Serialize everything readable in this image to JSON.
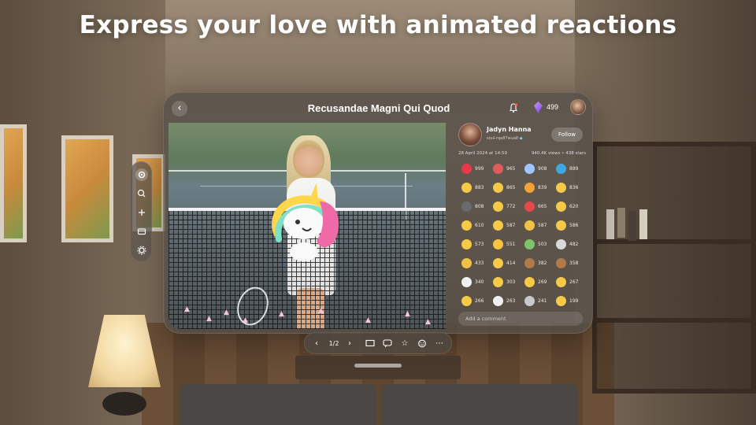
{
  "headline": "Express your love with animated reactions",
  "window": {
    "title": "Recusandae Magni Qui Quod",
    "gems": "499"
  },
  "channel": {
    "name": "Jadyn Hanna",
    "handle": "soul-rqa87wua8",
    "follow_label": "Follow",
    "date": "28 April 2024 at 14:59",
    "stats": "940.4K views • 438 stars",
    "comment_placeholder": "Add a comment"
  },
  "reactions": [
    {
      "icon": "heart-icon",
      "color": "#e8394a",
      "count": "999"
    },
    {
      "icon": "hundred-icon",
      "color": "#e05c5c",
      "count": "965"
    },
    {
      "icon": "comet-icon",
      "color": "#9fc7ff",
      "count": "908"
    },
    {
      "icon": "globe-icon",
      "color": "#3fa8e0",
      "count": "889"
    },
    {
      "icon": "hugging-face-icon",
      "color": "#f7c948",
      "count": "883"
    },
    {
      "icon": "astonished-face-icon",
      "color": "#f7c948",
      "count": "865"
    },
    {
      "icon": "party-popper-icon",
      "color": "#f0a33a",
      "count": "839"
    },
    {
      "icon": "worried-face-icon",
      "color": "#f7c948",
      "count": "836"
    },
    {
      "icon": "camera-icon",
      "color": "#6b6b6b",
      "count": "808"
    },
    {
      "icon": "heart-eyes-icon",
      "color": "#f7c948",
      "count": "772"
    },
    {
      "icon": "santa-icon",
      "color": "#e34b4b",
      "count": "665"
    },
    {
      "icon": "pleading-face-icon",
      "color": "#f7c948",
      "count": "620"
    },
    {
      "icon": "grinning-face-icon",
      "color": "#f7c948",
      "count": "610"
    },
    {
      "icon": "smiling-hearts-icon",
      "color": "#f7c948",
      "count": "587"
    },
    {
      "icon": "thumbs-up-icon",
      "color": "#f2c14a",
      "count": "587"
    },
    {
      "icon": "sunglasses-face-icon",
      "color": "#f7c948",
      "count": "586"
    },
    {
      "icon": "kissing-face-icon",
      "color": "#f7c948",
      "count": "573"
    },
    {
      "icon": "star-icon",
      "color": "#f6c342",
      "count": "551"
    },
    {
      "icon": "money-with-wings-icon",
      "color": "#7fc46b",
      "count": "503"
    },
    {
      "icon": "rocket-icon",
      "color": "#d9d9d9",
      "count": "482"
    },
    {
      "icon": "clapping-hands-icon",
      "color": "#f2c14a",
      "count": "433"
    },
    {
      "icon": "thinking-face-icon",
      "color": "#f7c948",
      "count": "414"
    },
    {
      "icon": "monkey-icon",
      "color": "#b07a4a",
      "count": "382"
    },
    {
      "icon": "see-no-evil-monkey-icon",
      "color": "#b07a4a",
      "count": "358"
    },
    {
      "icon": "ghost-icon",
      "color": "#f0f0f0",
      "count": "340"
    },
    {
      "icon": "smirking-face-icon",
      "color": "#f7c948",
      "count": "303"
    },
    {
      "icon": "tongue-face-icon",
      "color": "#f7c948",
      "count": "269"
    },
    {
      "icon": "heart-eyes-face-icon",
      "color": "#f7c948",
      "count": "267"
    },
    {
      "icon": "laughing-face-icon",
      "color": "#f7c948",
      "count": "266"
    },
    {
      "icon": "clown-face-icon",
      "color": "#f0f0f0",
      "count": "263"
    },
    {
      "icon": "alien-icon",
      "color": "#c9c9c9",
      "count": "241"
    },
    {
      "icon": "cat-face-icon",
      "color": "#f7c948",
      "count": "199"
    }
  ],
  "pager": "1/2",
  "side_toolbar": [
    "gear-icon",
    "search-icon",
    "plus-icon",
    "wallet-icon",
    "settings-icon"
  ],
  "bottom_bar": [
    "chevron-left-icon",
    "page-indicator",
    "chevron-right-icon",
    "aspect-ratio-icon",
    "chat-icon",
    "star-icon",
    "add-reaction-icon",
    "more-icon"
  ]
}
